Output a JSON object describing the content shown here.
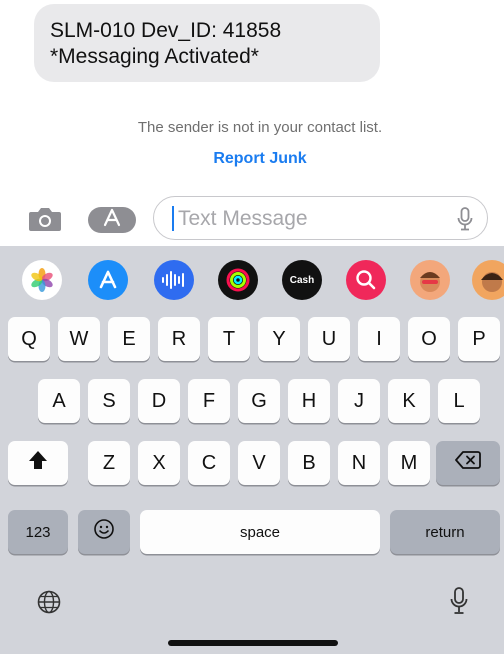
{
  "message": {
    "line1": "SLM-010 Dev_ID: 41858",
    "line2": "*Messaging Activated*"
  },
  "notice": "The sender is not in your contact list.",
  "report_junk_label": "Report Junk",
  "input": {
    "placeholder": "Text Message"
  },
  "app_strip": [
    {
      "name": "photos-app-icon"
    },
    {
      "name": "app-store-icon"
    },
    {
      "name": "audio-message-icon"
    },
    {
      "name": "fitness-activity-icon"
    },
    {
      "name": "apple-cash-icon",
      "label": "Cash"
    },
    {
      "name": "image-search-icon"
    },
    {
      "name": "memoji-icon"
    },
    {
      "name": "memoji-2-icon"
    }
  ],
  "keyboard": {
    "row1": [
      "Q",
      "W",
      "E",
      "R",
      "T",
      "Y",
      "U",
      "I",
      "O",
      "P"
    ],
    "row2": [
      "A",
      "S",
      "D",
      "F",
      "G",
      "H",
      "J",
      "K",
      "L"
    ],
    "row3": [
      "Z",
      "X",
      "C",
      "V",
      "B",
      "N",
      "M"
    ],
    "numbers_label": "123",
    "space_label": "space",
    "return_label": "return"
  },
  "colors": {
    "accent": "#1a7cf0",
    "bubble": "#e9e9eb",
    "keyboard_bg": "#d2d4da"
  }
}
